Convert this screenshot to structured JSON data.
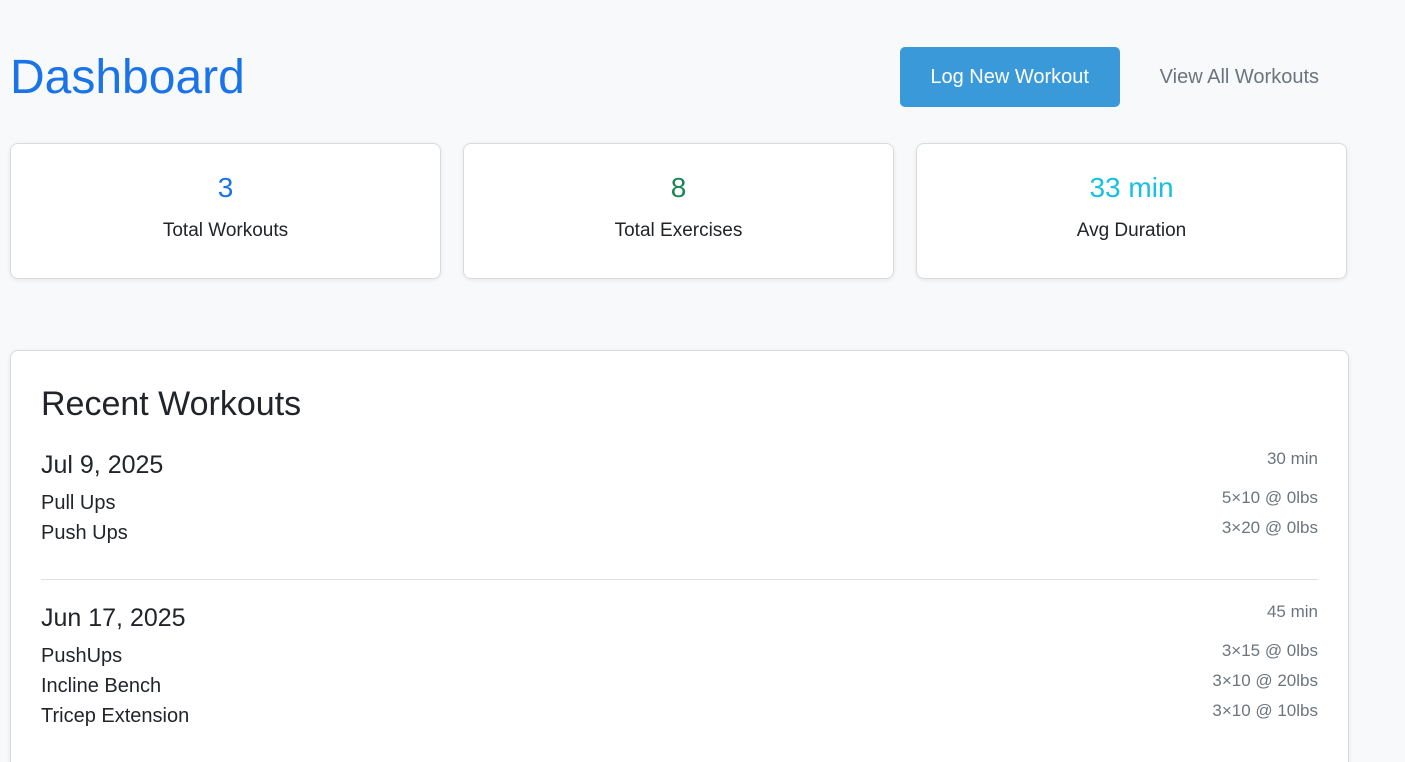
{
  "header": {
    "title": "Dashboard",
    "log_button": "Log New Workout",
    "view_all_link": "View All Workouts"
  },
  "stats": [
    {
      "value": "3",
      "label": "Total Workouts",
      "color": "#1a73e8"
    },
    {
      "value": "8",
      "label": "Total Exercises",
      "color": "#198754"
    },
    {
      "value": "33 min",
      "label": "Avg Duration",
      "color": "#17c0e0"
    }
  ],
  "recent": {
    "title": "Recent Workouts",
    "workouts": [
      {
        "date": "Jul 9, 2025",
        "duration": "30 min",
        "exercises": [
          {
            "name": "Pull Ups",
            "detail": "5×10 @ 0lbs"
          },
          {
            "name": "Push Ups",
            "detail": "3×20 @ 0lbs"
          }
        ]
      },
      {
        "date": "Jun 17, 2025",
        "duration": "45 min",
        "exercises": [
          {
            "name": "PushUps",
            "detail": "3×15 @ 0lbs"
          },
          {
            "name": "Incline Bench",
            "detail": "3×10 @ 20lbs"
          },
          {
            "name": "Tricep Extension",
            "detail": "3×10 @ 10lbs"
          }
        ]
      }
    ]
  }
}
